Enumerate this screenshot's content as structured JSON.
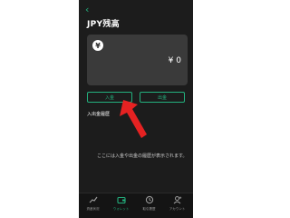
{
  "header": {
    "back_icon": "chevron-left-icon",
    "title": "JPY残高"
  },
  "balance_card": {
    "currency_icon": "yen-icon",
    "currency_symbol": "¥",
    "amount": "¥ 0"
  },
  "actions": {
    "deposit_label": "入金",
    "withdraw_label": "出金"
  },
  "history": {
    "section_label": "入出金履歴",
    "empty_message": "ここには入金や出金の履歴が表示されます。"
  },
  "tabbar": {
    "items": [
      {
        "label": "資産状況",
        "icon": "chart-icon",
        "active": false
      },
      {
        "label": "ウォレット",
        "icon": "wallet-icon",
        "active": true
      },
      {
        "label": "取引履歴",
        "icon": "history-icon",
        "active": false
      },
      {
        "label": "アカウント",
        "icon": "account-icon",
        "active": false
      }
    ]
  },
  "colors": {
    "accent": "#23b07d",
    "background": "#1c1c1c",
    "card": "#3a3a3a",
    "annotation": "#e52222"
  }
}
